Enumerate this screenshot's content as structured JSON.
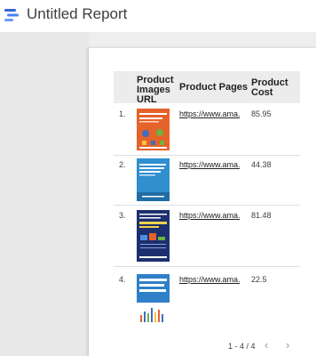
{
  "app": {
    "title": "Untitled Report"
  },
  "table": {
    "headers": {
      "images_url": "Product Images URL",
      "pages": "Product Pages",
      "cost": "Product Cost"
    },
    "rows": [
      {
        "num": "1.",
        "url": "https://www.ama…",
        "cost": "85.95",
        "cover": {
          "title": "Attribution Modelling",
          "bg": "#e5622a",
          "accent": "#ffffff"
        }
      },
      {
        "num": "2.",
        "url": "https://www.ama…",
        "cost": "44.38",
        "cover": {
          "title": "Maths and Stats for Web Analytics",
          "bg": "#2f8fcf",
          "accent": "#ffffff"
        }
      },
      {
        "num": "3.",
        "url": "https://www.ama…",
        "cost": "81.48",
        "cover": {
          "title": "Attribution Modelling in GOOGLE ANALYTICS",
          "bg": "#1d2f6e",
          "accent": "#f2d24a"
        }
      },
      {
        "num": "4.",
        "url": "https://www.ama…",
        "cost": "22.5",
        "cover": {
          "title": "EMAIL MARKETING ANALYTICS",
          "bg": "#2f7fc9",
          "accent": "#ffffff"
        }
      }
    ]
  },
  "pagination": {
    "range": "1 - 4 / 4",
    "prev_icon": "chevron-left-icon",
    "next_icon": "chevron-right-icon"
  }
}
